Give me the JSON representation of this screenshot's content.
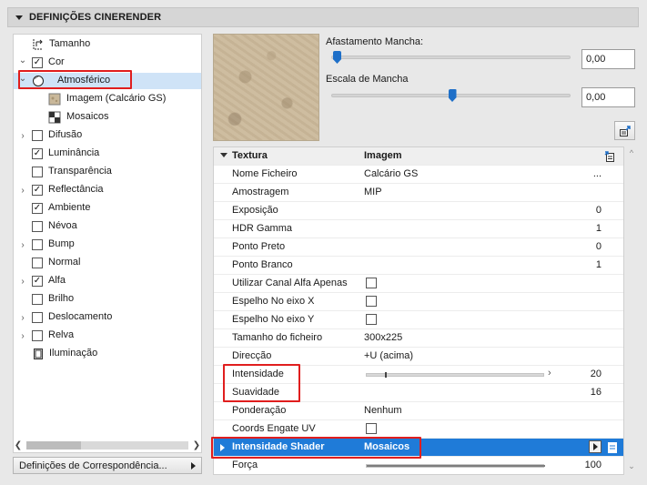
{
  "header": {
    "title": "DEFINIÇÕES CINERENDER"
  },
  "tree": {
    "items": [
      {
        "label": "Tamanho",
        "expander": "",
        "checkbox": "none",
        "icon": "size-icon"
      },
      {
        "label": "Cor",
        "expander": "expanded",
        "checkbox": "checked",
        "icon": ""
      },
      {
        "label": "Atmosférico",
        "expander": "expanded",
        "checkbox": "none",
        "icon": "sphere-icon",
        "selected": true
      },
      {
        "label": "Imagem (Calcário GS)",
        "expander": "",
        "checkbox": "none",
        "icon": "texture-image-icon"
      },
      {
        "label": "Mosaicos",
        "expander": "",
        "checkbox": "none",
        "icon": "tiles-icon"
      },
      {
        "label": "Difusão",
        "expander": "collapsed",
        "checkbox": "unchecked",
        "icon": ""
      },
      {
        "label": "Luminância",
        "expander": "",
        "checkbox": "checked",
        "icon": ""
      },
      {
        "label": "Transparência",
        "expander": "",
        "checkbox": "unchecked",
        "icon": ""
      },
      {
        "label": "Reflectância",
        "expander": "collapsed",
        "checkbox": "checked",
        "icon": ""
      },
      {
        "label": "Ambiente",
        "expander": "",
        "checkbox": "checked",
        "icon": ""
      },
      {
        "label": "Névoa",
        "expander": "",
        "checkbox": "unchecked",
        "icon": ""
      },
      {
        "label": "Bump",
        "expander": "collapsed",
        "checkbox": "unchecked",
        "icon": ""
      },
      {
        "label": "Normal",
        "expander": "",
        "checkbox": "unchecked",
        "icon": ""
      },
      {
        "label": "Alfa",
        "expander": "collapsed",
        "checkbox": "checked",
        "icon": ""
      },
      {
        "label": "Brilho",
        "expander": "",
        "checkbox": "unchecked",
        "icon": ""
      },
      {
        "label": "Deslocamento",
        "expander": "collapsed",
        "checkbox": "unchecked",
        "icon": ""
      },
      {
        "label": "Relva",
        "expander": "collapsed",
        "checkbox": "unchecked",
        "icon": ""
      },
      {
        "label": "Iluminação",
        "expander": "",
        "checkbox": "none",
        "icon": "illumination-icon"
      }
    ]
  },
  "mapping_button": {
    "label": "Definições de Correspondência..."
  },
  "sliders": [
    {
      "label": "Afastamento Mancha:",
      "value": "0,00",
      "level": 0.0
    },
    {
      "label": "Escala de Mancha",
      "value": "0,00",
      "level": 0.5
    }
  ],
  "table": {
    "header": {
      "name": "Textura",
      "value": "Imagem"
    },
    "rows": [
      {
        "name": "Nome Ficheiro",
        "value": "Calcário GS",
        "num": "...",
        "kind": "text"
      },
      {
        "name": "Amostragem",
        "value": "MIP",
        "num": "",
        "kind": "text"
      },
      {
        "name": "Exposição",
        "value": "",
        "num": "0",
        "kind": "text"
      },
      {
        "name": "HDR Gamma",
        "value": "",
        "num": "1",
        "kind": "text"
      },
      {
        "name": "Ponto Preto",
        "value": "",
        "num": "0",
        "kind": "text"
      },
      {
        "name": "Ponto Branco",
        "value": "",
        "num": "1",
        "kind": "text"
      },
      {
        "name": "Utilizar Canal Alfa Apenas",
        "value": "",
        "num": "",
        "kind": "checkbox"
      },
      {
        "name": "Espelho No eixo X",
        "value": "",
        "num": "",
        "kind": "checkbox"
      },
      {
        "name": "Espelho No eixo Y",
        "value": "",
        "num": "",
        "kind": "checkbox"
      },
      {
        "name": "Tamanho do ficheiro",
        "value": "300x225",
        "num": "",
        "kind": "text"
      },
      {
        "name": "Direcção",
        "value": "+U (acima)",
        "num": "",
        "kind": "text"
      },
      {
        "name": "Intensidade",
        "value": "",
        "num": "20",
        "kind": "slider",
        "level": 0.1
      },
      {
        "name": "Suavidade",
        "value": "",
        "num": "16",
        "kind": "text"
      },
      {
        "name": "Ponderação",
        "value": "Nenhum",
        "num": "",
        "kind": "text"
      },
      {
        "name": "Coords Engate UV",
        "value": "",
        "num": "",
        "kind": "checkbox"
      },
      {
        "name": "Intensidade Shader",
        "value": "Mosaicos",
        "num": "",
        "kind": "highlight"
      },
      {
        "name": "Força",
        "value": "",
        "num": "100",
        "kind": "slider",
        "level": 1.0
      }
    ]
  },
  "colors": {
    "selection": "#1f7bd8",
    "tree_selection": "#cfe3f7",
    "annotation": "#e01e1e",
    "slider_thumb": "#1e6fc8"
  }
}
